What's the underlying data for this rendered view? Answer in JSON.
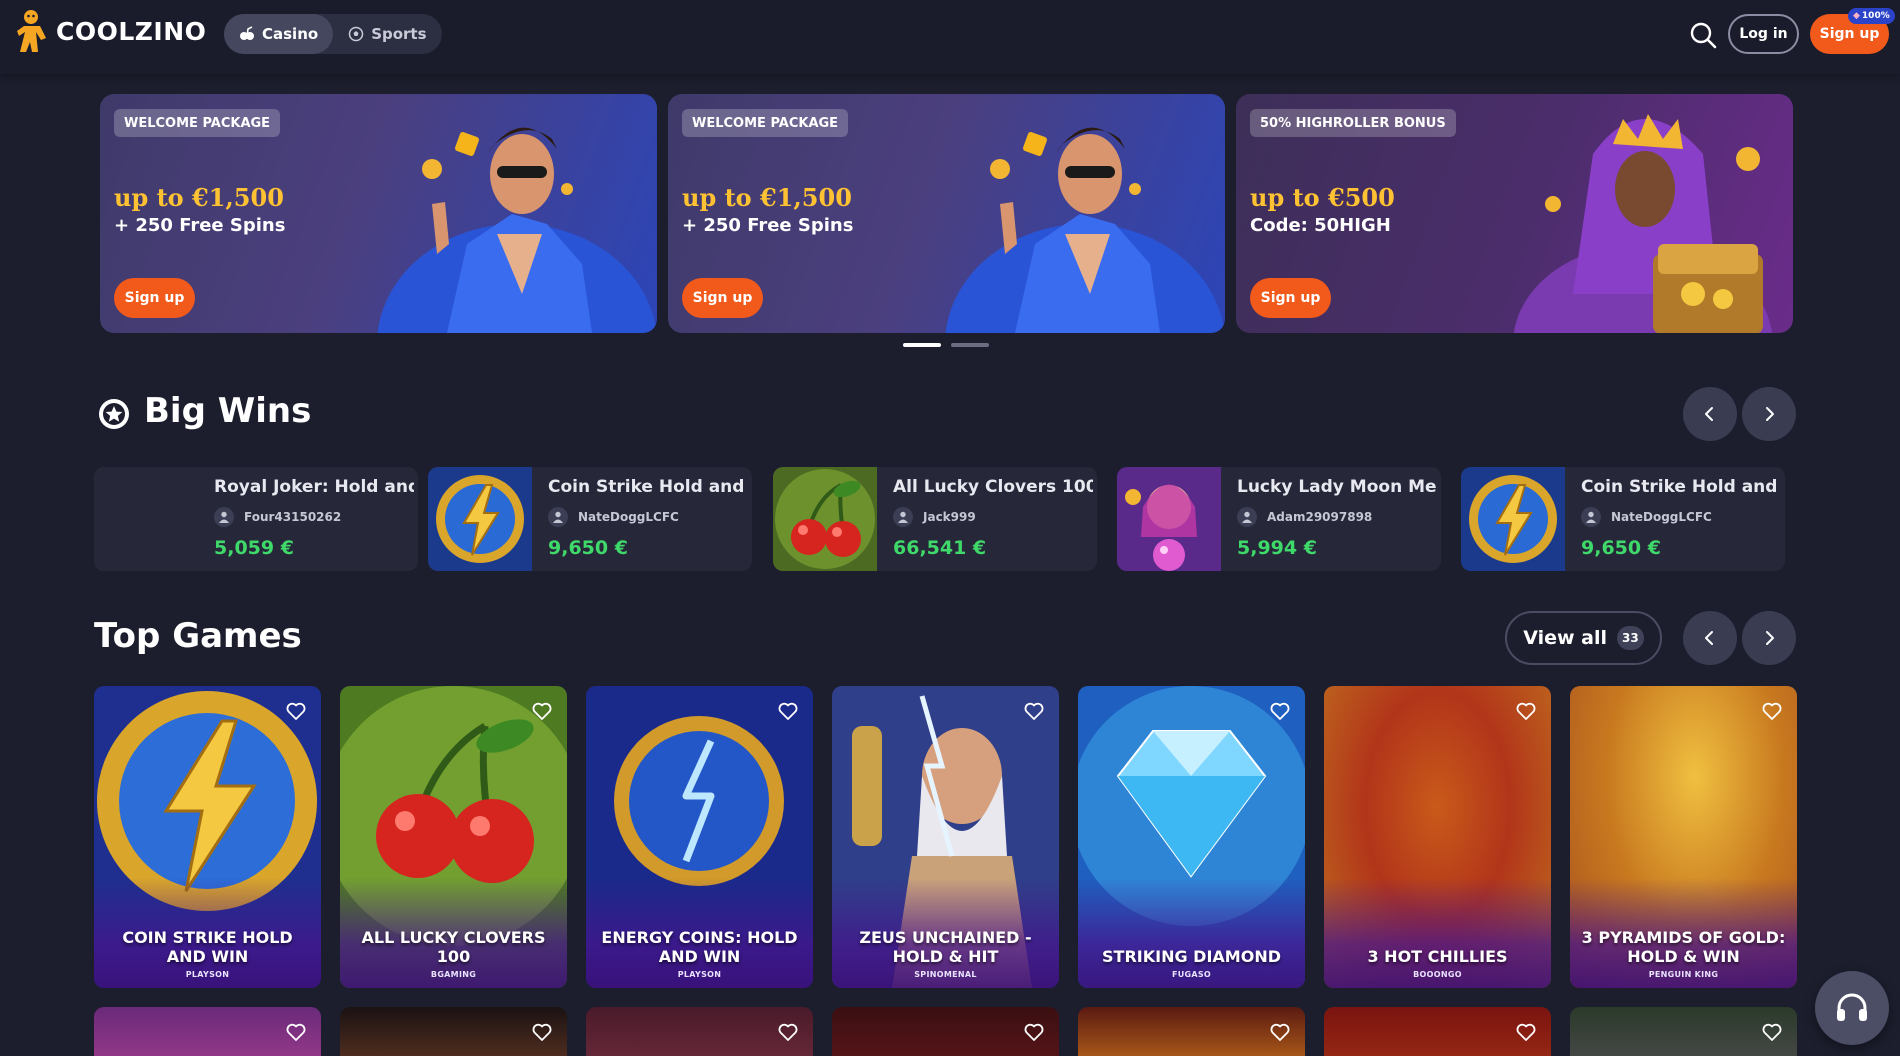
{
  "header": {
    "brand": "COOLZINO",
    "tabs": [
      {
        "label": "Casino",
        "icon": "casino-icon",
        "active": true
      },
      {
        "label": "Sports",
        "icon": "sports-ball-icon",
        "active": false
      }
    ],
    "login_label": "Log in",
    "signup_label": "Sign up",
    "signup_badge": "100%",
    "accent": "#f25a1c"
  },
  "banners": [
    {
      "tag": "WELCOME PACKAGE",
      "title": "up to €1,500",
      "subtitle": "+ 250 Free Spins",
      "button": "Sign up"
    },
    {
      "tag": "WELCOME PACKAGE",
      "title": "up to €1,500",
      "subtitle": "+ 250 Free Spins",
      "button": "Sign up"
    },
    {
      "tag": "50% HIGHROLLER BONUS",
      "title": "up to €500",
      "subtitle": "Code: 50HIGH",
      "button": "Sign up"
    }
  ],
  "big_wins": {
    "title": "Big Wins",
    "items": [
      {
        "game": "Royal Joker: Hold and Win",
        "user": "Four43150262",
        "amount": "5,059 €"
      },
      {
        "game": "Coin Strike Hold and Win",
        "user": "NateDoggLCFC",
        "amount": "9,650 €"
      },
      {
        "game": "All Lucky Clovers 100",
        "user": "Jack999",
        "amount": "66,541 €"
      },
      {
        "game": "Lucky Lady Moon Megaways",
        "user": "Adam29097898",
        "amount": "5,994 €"
      },
      {
        "game": "Coin Strike Hold and Win",
        "user": "NateDoggLCFC",
        "amount": "9,650 €"
      }
    ]
  },
  "top_games": {
    "title": "Top Games",
    "view_all_label": "View all",
    "view_all_count": "33",
    "games": [
      {
        "name": "COIN STRIKE HOLD AND WIN",
        "provider": "PLAYSON"
      },
      {
        "name": "ALL LUCKY CLOVERS 100",
        "provider": "BGAMING"
      },
      {
        "name": "ENERGY COINS: HOLD AND WIN",
        "provider": "PLAYSON"
      },
      {
        "name": "ZEUS UNCHAINED - HOLD & HIT",
        "provider": "SPINOMENAL"
      },
      {
        "name": "STRIKING DIAMOND",
        "provider": "FUGASO"
      },
      {
        "name": "3 HOT CHILLIES",
        "provider": "BOOONGO"
      },
      {
        "name": "3 PYRAMIDS OF GOLD: HOLD & WIN",
        "provider": "PENGUIN KING"
      }
    ]
  }
}
